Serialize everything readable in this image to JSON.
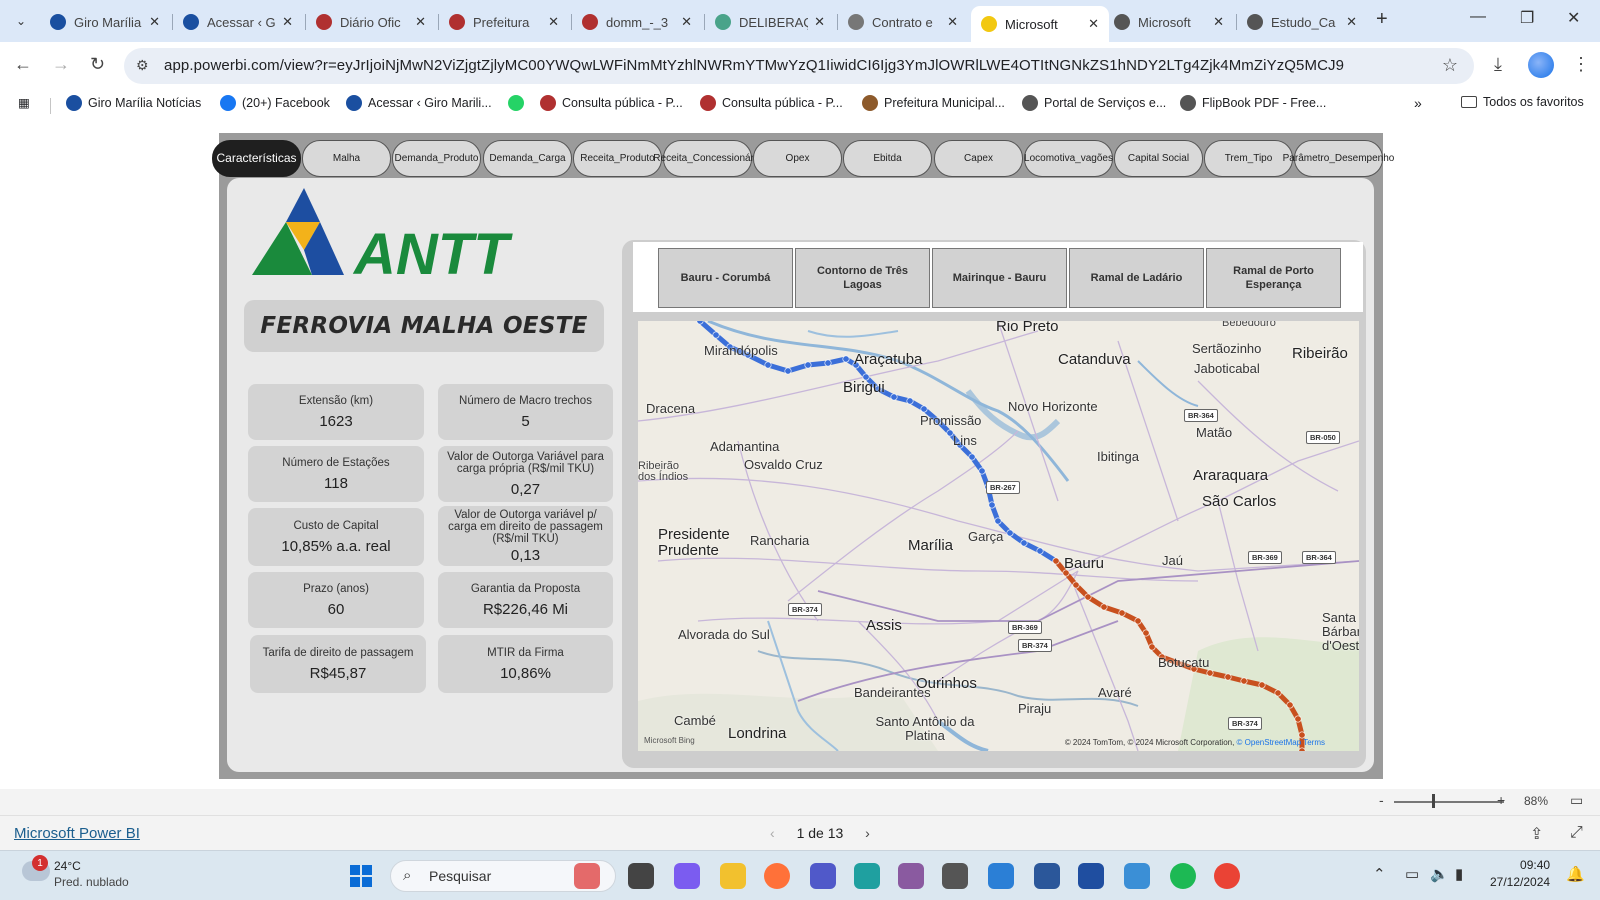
{
  "browser": {
    "tabs": [
      {
        "title": "Giro Marília",
        "color": "#1a4fa0"
      },
      {
        "title": "Acessar ‹ G",
        "color": "#1a4fa0"
      },
      {
        "title": "Diário Ofic",
        "color": "#b03030"
      },
      {
        "title": "Prefeitura",
        "color": "#b03030"
      },
      {
        "title": "domm_-_3",
        "color": "#b03030"
      },
      {
        "title": "DELIBERAÇ",
        "color": "#4aa38a"
      },
      {
        "title": "Contrato e",
        "color": "#777777"
      },
      {
        "title": "Microsoft",
        "color": "#f2c811"
      },
      {
        "title": "Microsoft",
        "color": "#555555"
      },
      {
        "title": "Estudo_Ca",
        "color": "#555555"
      }
    ],
    "url": "app.powerbi.com/view?r=eyJrIjoiNjMwN2ViZjgtZjlyMC00YWQwLWFiNmMtYzhlNWRmYTMwYzQ1IiwidCI6Ijg3YmJlOWRlLWE4OTItNGNkZS1hNDY2LTg4Zjk4MmZiYzQ5MCJ9",
    "bookmarks": [
      {
        "label": "Giro Marília Notícias",
        "color": "#1a4fa0"
      },
      {
        "label": "(20+) Facebook",
        "color": "#1877f2"
      },
      {
        "label": "Acessar ‹ Giro Marili...",
        "color": "#1a4fa0"
      },
      {
        "label": "",
        "color": "#25d366"
      },
      {
        "label": "Consulta pública - P...",
        "color": "#b03030"
      },
      {
        "label": "Consulta pública - P...",
        "color": "#b03030"
      },
      {
        "label": "Prefeitura Municipal...",
        "color": "#8d5a2b"
      },
      {
        "label": "Portal de Serviços e...",
        "color": "#555555"
      },
      {
        "label": "FlipBook PDF - Free...",
        "color": "#555555"
      }
    ],
    "bookmarks_more": "»",
    "all_favorites": "Todos os favoritos"
  },
  "report": {
    "nav_pages": [
      {
        "label": "Características",
        "active": true
      },
      {
        "label": "Malha"
      },
      {
        "label": "Demanda_Produto"
      },
      {
        "label": "Demanda_Carga"
      },
      {
        "label": "Receita_Produto"
      },
      {
        "label": "Receita_Concessionária"
      },
      {
        "label": "Opex"
      },
      {
        "label": "Ebitda"
      },
      {
        "label": "Capex"
      },
      {
        "label": "Locomotiva_vagões"
      },
      {
        "label": "Capital Social"
      },
      {
        "label": "Trem_Tipo"
      },
      {
        "label": "Parâmetro_Desempenho"
      }
    ],
    "logo_text": "ANTT",
    "banner": "FERROVIA MALHA OESTE",
    "kpis": [
      {
        "label": "Extensão (km)",
        "value": "1623"
      },
      {
        "label": "Número de Macro trechos",
        "value": "5"
      },
      {
        "label": "Número de Estações",
        "value": "118"
      },
      {
        "label": "Valor de Outorga Variável para carga própria (R$/mil TKU)",
        "value": "0,27"
      },
      {
        "label": "Custo de Capital",
        "value": "10,85% a.a. real"
      },
      {
        "label": "Valor de Outorga variável p/ carga em direito de passagem (R$/mil TKU)",
        "value": "0,13"
      },
      {
        "label": "Prazo (anos)",
        "value": "60"
      },
      {
        "label": "Garantia da Proposta",
        "value": "R$226,46 Mi"
      },
      {
        "label": "Tarifa de direito de passagem",
        "value": "R$45,87"
      },
      {
        "label": "MTIR da Firma",
        "value": "10,86%"
      }
    ],
    "segment_tabs": [
      "Bauru - Corumbá",
      "Contorno de Três Lagoas",
      "Mairinque - Bauru",
      "Ramal de Ladário",
      "Ramal de Porto Esperança"
    ],
    "map": {
      "places": [
        {
          "name": "Rio Preto",
          "size": "big"
        },
        {
          "name": "Bebedouro",
          "size": "small"
        },
        {
          "name": "Mirandópolis",
          "size": "normal"
        },
        {
          "name": "Araçatuba",
          "size": "big"
        },
        {
          "name": "Catanduva",
          "size": "big"
        },
        {
          "name": "Sertãozinho",
          "size": "normal"
        },
        {
          "name": "Ribeirão",
          "size": "big"
        },
        {
          "name": "Jaboticabal",
          "size": "normal"
        },
        {
          "name": "Birigui",
          "size": "big"
        },
        {
          "name": "Dracena",
          "size": "normal"
        },
        {
          "name": "Novo Horizonte",
          "size": "normal"
        },
        {
          "name": "Promissão",
          "size": "normal"
        },
        {
          "name": "Matão",
          "size": "normal"
        },
        {
          "name": "Adamantina",
          "size": "normal"
        },
        {
          "name": "Lins",
          "size": "normal"
        },
        {
          "name": "Ibitinga",
          "size": "normal"
        },
        {
          "name": "Ribeirão dos Índios",
          "size": "small"
        },
        {
          "name": "Osvaldo Cruz",
          "size": "normal"
        },
        {
          "name": "Araraquara",
          "size": "big"
        },
        {
          "name": "São Carlos",
          "size": "big"
        },
        {
          "name": "Presidente Prudente",
          "size": "big"
        },
        {
          "name": "Rancharia",
          "size": "normal"
        },
        {
          "name": "Marília",
          "size": "big"
        },
        {
          "name": "Garça",
          "size": "normal"
        },
        {
          "name": "Jaú",
          "size": "normal"
        },
        {
          "name": "Bauru",
          "size": "big"
        },
        {
          "name": "Alvorada do Sul",
          "size": "normal"
        },
        {
          "name": "Assis",
          "size": "big"
        },
        {
          "name": "Botucatu",
          "size": "normal"
        },
        {
          "name": "Santa Bárbara d'Oeste",
          "size": "normal"
        },
        {
          "name": "Ourinhos",
          "size": "big"
        },
        {
          "name": "Bandeirantes",
          "size": "normal"
        },
        {
          "name": "Avaré",
          "size": "normal"
        },
        {
          "name": "Piraju",
          "size": "normal"
        },
        {
          "name": "Cambé",
          "size": "normal"
        },
        {
          "name": "Santo Antônio da Platina",
          "size": "normal"
        },
        {
          "name": "Londrina",
          "size": "big"
        }
      ],
      "highways": [
        "BR-364",
        "BR-050",
        "BR-267",
        "BR-369",
        "BR-364",
        "BR-374",
        "BR-369",
        "BR-374",
        "BR-374"
      ],
      "copyright": "© 2024 TomTom, © 2024 Microsoft Corporation,",
      "copyright_link": "© OpenStreetMap",
      "terms": "Terms",
      "ms_logo": "Microsoft Bing"
    }
  },
  "footer": {
    "zoom": "88%",
    "powerbi_link": "Microsoft Power BI",
    "pager": "1 de 13"
  },
  "taskbar": {
    "notification_count": "1",
    "temperature": "24°C",
    "weather": "Pred. nublado",
    "search_placeholder": "Pesquisar",
    "time": "09:40",
    "date": "27/12/2024"
  }
}
